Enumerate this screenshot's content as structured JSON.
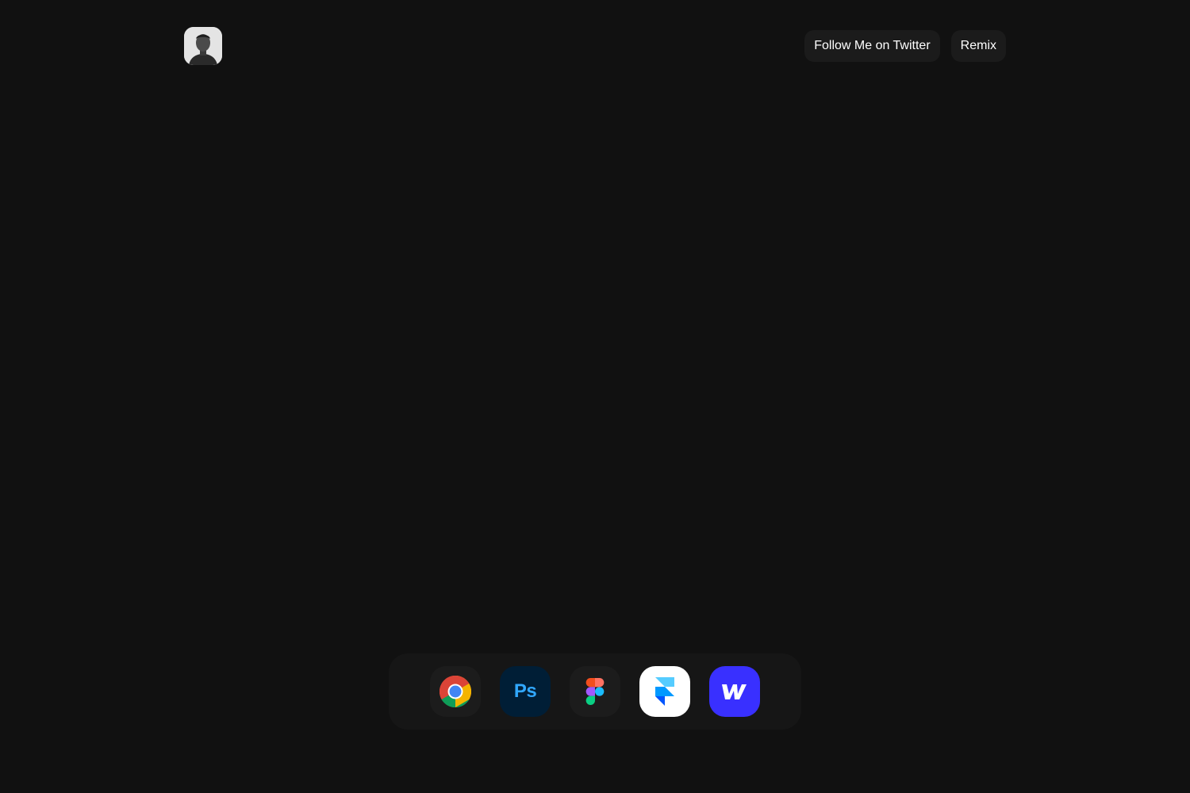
{
  "header": {
    "avatar_icon": "profile-photo-avatar",
    "buttons": {
      "twitter_label": "Follow Me on Twitter",
      "remix_label": "Remix"
    }
  },
  "dock": {
    "apps": [
      {
        "name": "Chrome",
        "icon": "chrome-icon",
        "tile_color": "#1c1c1c"
      },
      {
        "name": "Photoshop",
        "icon": "photoshop-icon",
        "label": "Ps",
        "tile_color": "#001e36",
        "text_color": "#31a8ff"
      },
      {
        "name": "Figma",
        "icon": "figma-icon",
        "tile_color": "#1c1c1c"
      },
      {
        "name": "Framer",
        "icon": "framer-icon",
        "tile_color": "#ffffff"
      },
      {
        "name": "Webflow",
        "icon": "webflow-icon",
        "tile_color": "#3930ff"
      }
    ]
  },
  "colors": {
    "background": "#111111",
    "button_bg": "#1b1b1b",
    "dock_bg": "#161616"
  }
}
